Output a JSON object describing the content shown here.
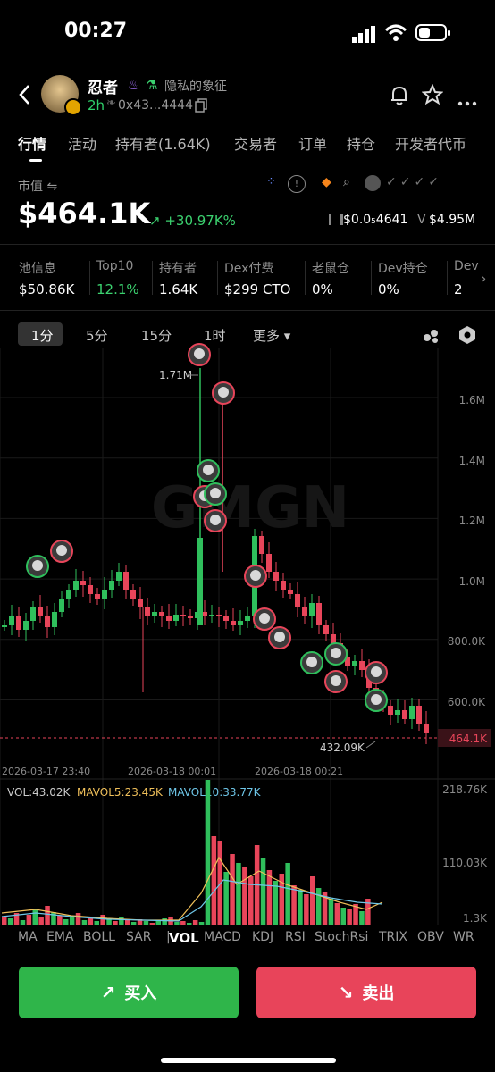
{
  "status_bar": {
    "time": "00:27"
  },
  "header": {
    "token_name": "忍者",
    "privacy_tag": "隐私的象征",
    "age": "2h",
    "address": "0x43...4444"
  },
  "tabs": [
    "行情",
    "活动",
    "持有者(1.64K)",
    "交易者",
    "订单",
    "持仓",
    "开发者代币"
  ],
  "market": {
    "label": "市值 ⇋",
    "cap": "$464.1K",
    "change": "↗ +30.97K%",
    "price": "$0.0₅4641",
    "volume": "$4.95M",
    "price_icon": "candle-icon",
    "volume_prefix": "V"
  },
  "stats": [
    {
      "label": "池信息",
      "value": "$50.86K"
    },
    {
      "label": "Top10",
      "value": "12.1%"
    },
    {
      "label": "持有者",
      "value": "1.64K"
    },
    {
      "label": "Dex付费",
      "value": "$299 CTO"
    },
    {
      "label": "老鼠仓",
      "value": "0%"
    },
    {
      "label": "Dev持仓",
      "value": "0%"
    },
    {
      "label": "Dev",
      "value": "2"
    }
  ],
  "timeframes": [
    "1分",
    "5分",
    "15分",
    "1时",
    "更多 ▾"
  ],
  "chart_data": [
    {
      "type": "candlestick",
      "y_axis_labels": [
        "1.6M",
        "1.4M",
        "1.2M",
        "1.0M",
        "800.0K",
        "600.0K"
      ],
      "current_price_label": "464.1K",
      "high_label": "1.71M",
      "low_label": "432.09K",
      "x_labels": [
        "2026-03-17 23:40",
        "2026-03-18 00:01",
        "2026-03-18 00:21"
      ]
    },
    {
      "type": "bar",
      "title": "VOL:43.02K",
      "series": [
        {
          "name": "MAVOL5:23.45K"
        },
        {
          "name": "MAVOL10:33.77K"
        }
      ],
      "y_axis_labels": [
        "218.76K",
        "110.03K",
        "1.3K"
      ]
    }
  ],
  "indicators": [
    "MA",
    "EMA",
    "BOLL",
    "SAR",
    "|",
    "VOL",
    "MACD",
    "KDJ",
    "RSI",
    "StochRsi",
    "TRIX",
    "OBV",
    "WR"
  ],
  "actions": {
    "buy": "买入",
    "sell": "卖出"
  },
  "colors": {
    "up": "#2fbf5c",
    "down": "#e8455a",
    "buy_button": "#2fb54a",
    "sell_button": "#e8445a"
  }
}
